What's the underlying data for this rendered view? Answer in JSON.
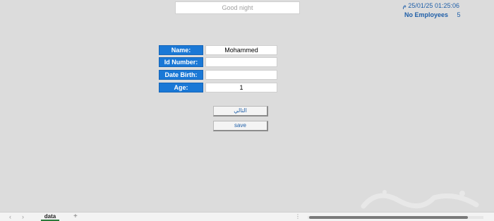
{
  "header": {
    "greeting": "Good night",
    "datetime": "01:25:06 25/01/25 م",
    "employees_label": "No Employees",
    "employees_count": "5"
  },
  "form": {
    "name_label": "Name:",
    "name_value": "Mohammed",
    "id_label": "Id Number:",
    "id_value": "",
    "dob_label": "Date Birth:",
    "dob_value": "",
    "age_label": "Age:",
    "age_value": "1"
  },
  "buttons": {
    "first_label": "التالي",
    "save_label": "save"
  },
  "sheet": {
    "tab_label": "data",
    "add_symbol": "+",
    "prev_arrow": "‹",
    "next_arrow": "›",
    "more_symbol": "⋮"
  },
  "colors": {
    "label_bg": "#1a78d6",
    "accent_text": "#1f5fa8"
  }
}
